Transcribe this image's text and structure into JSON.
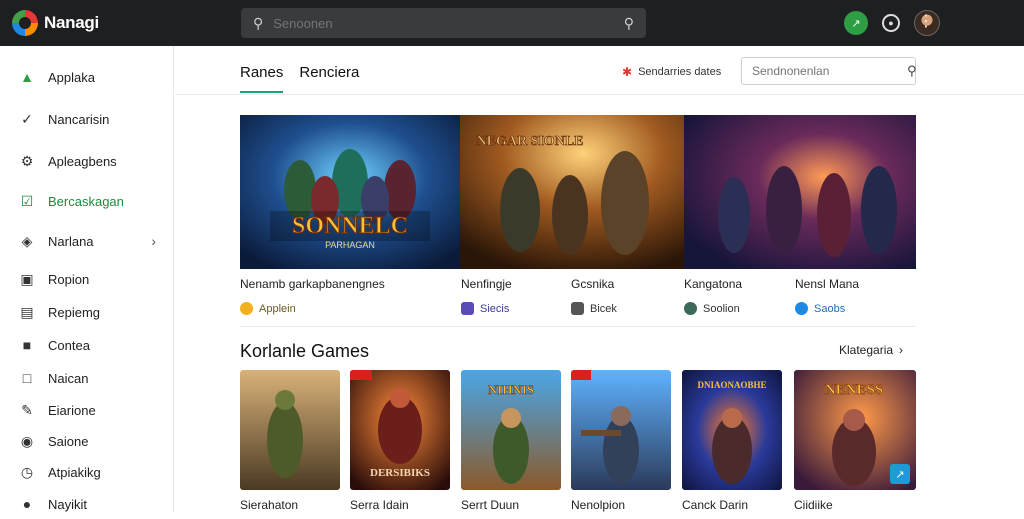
{
  "app": {
    "brand": "Nanagi",
    "search_placeholder": "Senoonen"
  },
  "topbar": {
    "kebab": "⋮"
  },
  "sidebar": {
    "items": [
      {
        "label": "Applaka",
        "icon": "app-icon",
        "style": "normal"
      },
      {
        "label": "Nancarisin",
        "icon": "check-icon",
        "style": "normal"
      },
      {
        "label": "Apleagbens",
        "icon": "gear-icon",
        "style": "normal"
      },
      {
        "label": "Bercaskagan",
        "icon": "checkbox-icon",
        "style": "green"
      },
      {
        "label": "Narlana",
        "icon": "gamepad-icon",
        "style": "normal",
        "chevron": "›"
      },
      {
        "label": "Ropion",
        "icon": "window-icon",
        "style": "normal"
      },
      {
        "label": "Repiemg",
        "icon": "doc-icon",
        "style": "normal"
      },
      {
        "label": "Contea",
        "icon": "square-icon",
        "style": "normal"
      },
      {
        "label": "Naican",
        "icon": "square-outline-icon",
        "style": "normal"
      },
      {
        "label": "Eiarione",
        "icon": "pencil-icon",
        "style": "normal"
      },
      {
        "label": "Saione",
        "icon": "camera-icon",
        "style": "normal"
      },
      {
        "label": "Atpiakikg",
        "icon": "clock-icon",
        "style": "normal"
      },
      {
        "label": "Nayikit",
        "icon": "user-icon",
        "style": "normal"
      }
    ]
  },
  "main": {
    "tabs": [
      {
        "label": "Ranes"
      },
      {
        "label": "Renciera"
      }
    ],
    "sort_label": "Sendarries dates",
    "search_placeholder": "Sendnonenlan",
    "featured": [
      {
        "title": "Nenamb garkapbanengnes",
        "meta": "Applein",
        "meta_color": "#f2b01e",
        "banner": "SONNELC",
        "banner_sub": "PARHAGAN"
      },
      {
        "title": "Nenfingje",
        "meta": "Siecis",
        "meta_color": "#5a4bb8",
        "banner": "NEGAR SIONLE",
        "banner_sub": ""
      },
      {
        "title": "Gcsnika",
        "meta": "Bicek",
        "meta_color": "#555555",
        "banner": "",
        "banner_sub": ""
      },
      {
        "title": "Kangatona",
        "meta": "Soolion",
        "meta_color": "#3b6a5a",
        "banner": "",
        "banner_sub": ""
      },
      {
        "title": "Nensl Mana",
        "meta": "Saobs",
        "meta_color": "#1e88e5",
        "banner": "",
        "banner_sub": ""
      }
    ],
    "section": {
      "title": "Korlanle Games",
      "link": "Klategaria",
      "link_chevron": "›"
    },
    "games": [
      {
        "title": "Sierahaton",
        "cover_text": ""
      },
      {
        "title": "Serra Idain",
        "cover_text": "DERSIBIKS"
      },
      {
        "title": "Serrt Duun",
        "cover_text": "NIHNIS"
      },
      {
        "title": "Nenolpion",
        "cover_text": ""
      },
      {
        "title": "Canck Darin",
        "cover_text": "DNIAONAOBHE"
      },
      {
        "title": "Ciidiike",
        "cover_text": "NENESS"
      }
    ]
  }
}
